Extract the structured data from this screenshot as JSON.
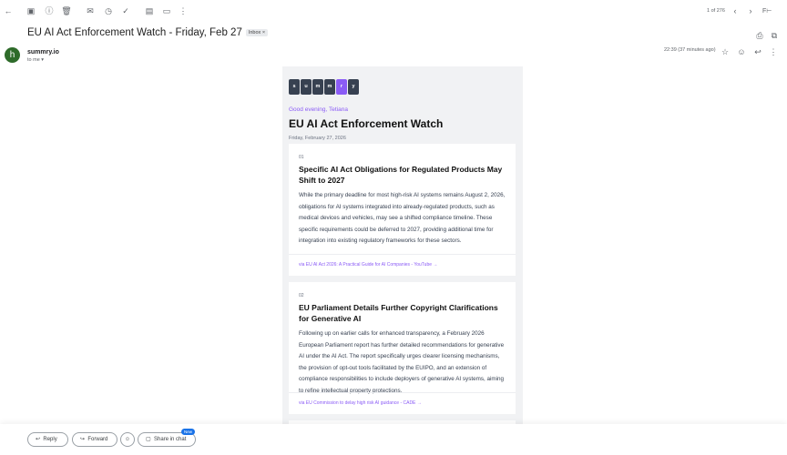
{
  "toolbar": {
    "pager": "1 of 276",
    "lang": "F⊢"
  },
  "header": {
    "subject": "EU AI Act Enforcement Watch - Friday, Feb 27",
    "label": "Inbox ×",
    "avatar_letter": "h",
    "sender": "summry.io",
    "to": "to me ▾",
    "time": "22:39 (37 minutes ago)"
  },
  "newsletter": {
    "logo": [
      "s",
      "u",
      "m",
      "m",
      "r",
      "y"
    ],
    "greeting": "Good evening, Tetiana",
    "title": "EU AI Act Enforcement Watch",
    "date": "Friday, February 27, 2026",
    "items": [
      {
        "num": "01",
        "title": "Specific AI Act Obligations for Regulated Products May Shift to 2027",
        "body": "While the primary deadline for most high-risk AI systems remains August 2, 2026, obligations for AI systems integrated into already-regulated products, such as medical devices and vehicles, may see a shifted compliance timeline. These specific requirements could be deferred to 2027, providing additional time for integration into existing regulatory frameworks for these sectors.",
        "source": "via EU AI Act 2026: A Practical Guide for AI Companies - YouTube →"
      },
      {
        "num": "02",
        "title": "EU Parliament Details Further Copyright Clarifications for Generative AI",
        "body": "Following up on earlier calls for enhanced transparency, a February 2026 European Parliament report has further detailed recommendations for generative AI under the AI Act. The report specifically urges clearer licensing mechanisms, the provision of opt-out tools facilitated by the EUIPO, and an extension of compliance responsibilities to include deployers of generative AI systems, aiming to refine intellectual property protections.",
        "source": "via EU Commission to delay high risk AI guidance - CADE →"
      }
    ]
  },
  "actions": {
    "reply": "Reply",
    "forward": "Forward",
    "share": "Share in chat",
    "new_badge": "New"
  }
}
